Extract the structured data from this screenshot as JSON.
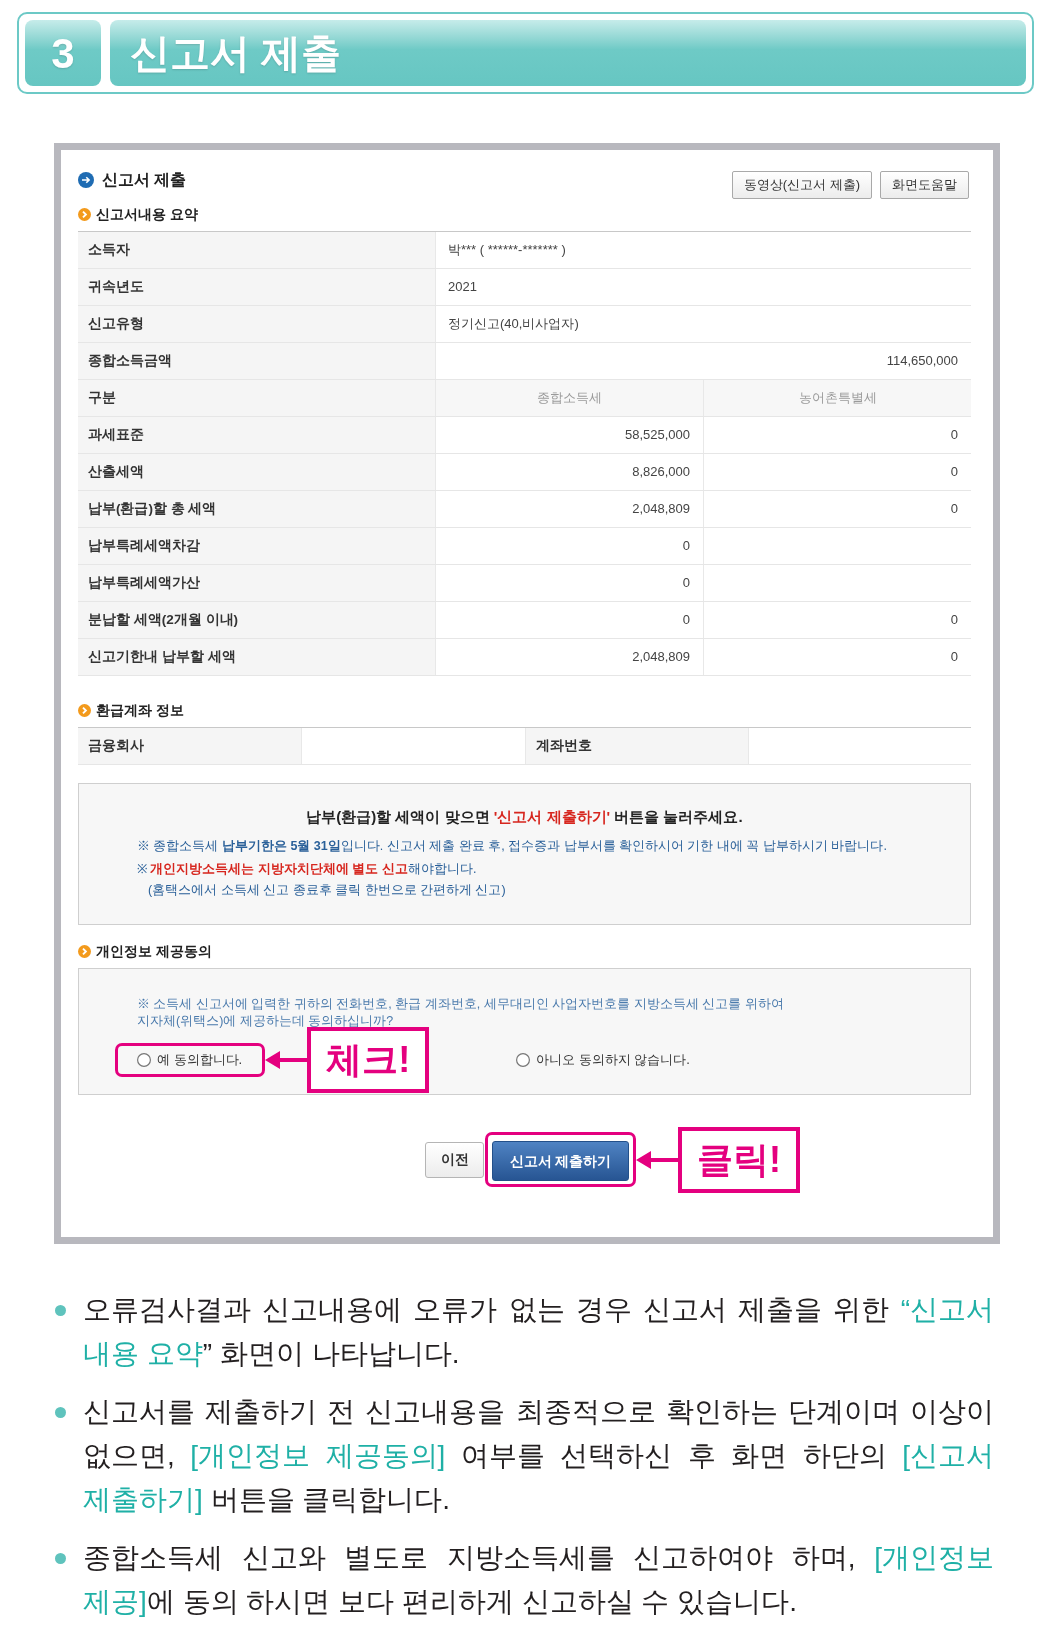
{
  "header": {
    "step": "3",
    "title": "신고서 제출"
  },
  "screen": {
    "title": "신고서 제출",
    "buttons": [
      {
        "label": "동영상(신고서 제출)"
      },
      {
        "label": "화면도움말"
      }
    ],
    "summary": {
      "heading": "신고서내용 요약",
      "rows": [
        {
          "label": "소득자",
          "kind": "text",
          "values": [
            "박*** ( ******-******* )"
          ]
        },
        {
          "label": "귀속년도",
          "kind": "text",
          "values": [
            "2021"
          ]
        },
        {
          "label": "신고유형",
          "kind": "text",
          "values": [
            "정기신고(40,비사업자)"
          ]
        },
        {
          "label": "종합소득금액",
          "kind": "amount",
          "values": [
            "114,650,000"
          ]
        },
        {
          "label": "구분",
          "kind": "header",
          "values": [
            "종합소득세",
            "농어촌특별세"
          ]
        },
        {
          "label": "과세표준",
          "kind": "split",
          "values": [
            "58,525,000",
            "0"
          ]
        },
        {
          "label": "산출세액",
          "kind": "split",
          "values": [
            "8,826,000",
            "0"
          ]
        },
        {
          "label": "납부(환급)할 총 세액",
          "kind": "split",
          "values": [
            "2,048,809",
            "0"
          ]
        },
        {
          "label": "납부특례세액차감",
          "kind": "split",
          "values": [
            "0"
          ]
        },
        {
          "label": "납부특례세액가산",
          "kind": "split",
          "values": [
            "0"
          ]
        },
        {
          "label": "분납할 세액(2개월 이내)",
          "kind": "split",
          "values": [
            "0",
            "0"
          ]
        },
        {
          "label": "신고기한내 납부할 세액",
          "kind": "split",
          "values": [
            "2,048,809",
            "0"
          ]
        }
      ]
    },
    "refund_account": {
      "heading": "환급계좌 정보",
      "fields": [
        {
          "label": "금융회사"
        },
        {
          "label": "계좌번호"
        }
      ]
    },
    "notice": {
      "title": [
        {
          "text": "납부(환급)할 세액이 맞으면 ",
          "kind": "plain"
        },
        {
          "text": "'신고서 제출하기'",
          "kind": "alert"
        },
        {
          "text": " 버튼을 눌러주세요.",
          "kind": "plain"
        }
      ],
      "lines": [
        {
          "kind": "note",
          "segments": [
            {
              "text": "※ 종합소득세 **납부기한은 5월 31일**입니다. 신고서 제출 완료 후, 접수증과 납부서를 확인하시어 기한 내에 꼭 납부하시기 바랍니다.",
              "kind": "plain"
            }
          ]
        },
        {
          "kind": "note",
          "segments": [
            {
              "text": "※ ",
              "kind": "plain"
            },
            {
              "text": "개인지방소득세는 지방자치단체에 별도 신고",
              "kind": "alert"
            },
            {
              "text": "해야합니다.",
              "kind": "plain"
            }
          ]
        },
        {
          "kind": "subnote",
          "segments": [
            {
              "text": "(홈택스에서 소득세 신고 종료후 클릭 한번으로 간편하게 신고)",
              "kind": "plain"
            }
          ]
        }
      ]
    },
    "privacy": {
      "heading": "개인정보 제공동의",
      "question": "※ 소득세 신고서에 입력한 귀하의 전화번호, 환급 계좌번호, 세무대리인 사업자번호를 지방소득세 신고를 위하여 지자체(위택스)에 제공하는데 동의하십니까?",
      "options": [
        {
          "label": "예 동의합니다.",
          "selected": false,
          "highlighted": true,
          "callout": "체크!"
        },
        {
          "label": "아니오 동의하지 않습니다.",
          "selected": false,
          "highlighted": false
        }
      ]
    },
    "actions": [
      {
        "label": "이전",
        "kind": "secondary",
        "highlighted": false
      },
      {
        "label": "신고서 제출하기",
        "kind": "primary",
        "highlighted": true,
        "callout": "클릭!"
      }
    ]
  },
  "bullets": [
    {
      "segments": [
        {
          "text": "오류검사결과 신고내용에 오류가 없는 경우 신고서 제출을 위한 ",
          "kind": "plain"
        },
        {
          "text": "“신고서 내용 요약",
          "kind": "accent"
        },
        {
          "text": "” 화면이 나타납니다.",
          "kind": "plain"
        }
      ]
    },
    {
      "segments": [
        {
          "text": "신고서를 제출하기 전 신고내용을 최종적으로 확인하는 단계이며 이상이 없으면, ",
          "kind": "plain"
        },
        {
          "text": "[개인정보 제공동의]",
          "kind": "accent"
        },
        {
          "text": " 여부를 선택하신 후 화면 하단의 ",
          "kind": "plain"
        },
        {
          "text": "[신고서 제출하기]",
          "kind": "accent"
        },
        {
          "text": " 버튼을 클릭합니다.",
          "kind": "plain"
        }
      ]
    },
    {
      "segments": [
        {
          "text": "종합소득세 신고와 별도로 지방소득세를 신고하여야 하며, ",
          "kind": "plain"
        },
        {
          "text": "[개인정보 제공]",
          "kind": "accent"
        },
        {
          "text": "에 동의 하시면 보다 편리하게 신고하실 수 있습니다.",
          "kind": "plain"
        }
      ]
    }
  ]
}
